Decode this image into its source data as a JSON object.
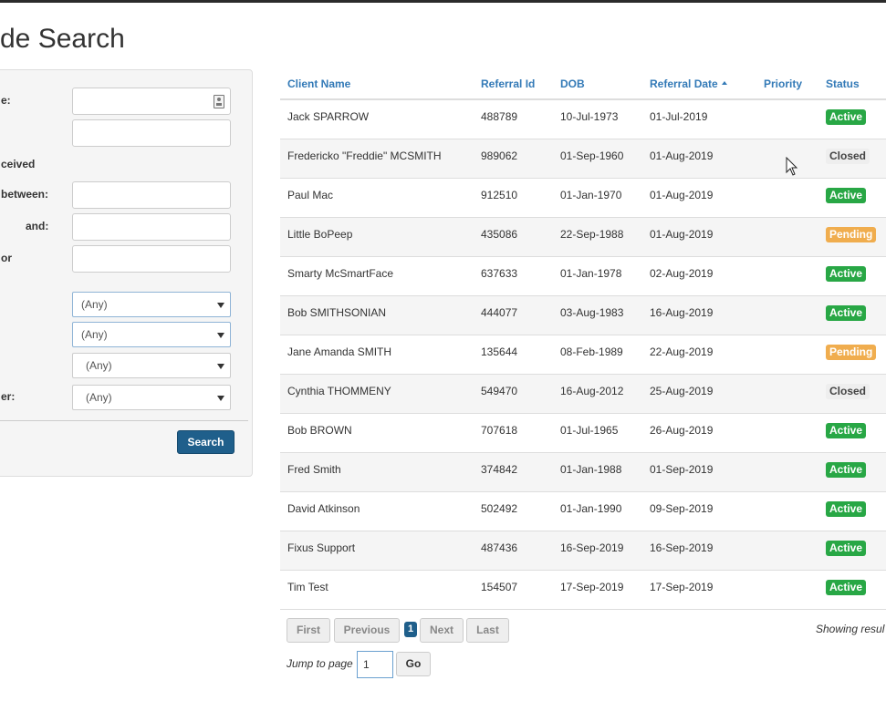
{
  "header": {
    "title": "de Search"
  },
  "filters": {
    "labels": {
      "name": "e:",
      "received": "ceived",
      "between": "between:",
      "and": "and:",
      "or": "or",
      "number": "er:"
    },
    "selects": [
      "(Any)",
      "(Any)",
      "(Any)",
      "(Any)"
    ],
    "search_label": "Search"
  },
  "table": {
    "columns": {
      "client_name": "Client Name",
      "referral_id": "Referral Id",
      "dob": "DOB",
      "referral_date": "Referral Date",
      "priority": "Priority",
      "status": "Status"
    },
    "rows": [
      {
        "name": "Jack SPARROW",
        "id": "488789",
        "dob": "10-Jul-1973",
        "date": "01-Jul-2019",
        "status": "Active"
      },
      {
        "name": "Fredericko \"Freddie\" MCSMITH",
        "id": "989062",
        "dob": "01-Sep-1960",
        "date": "01-Aug-2019",
        "status": "Closed"
      },
      {
        "name": "Paul Mac",
        "id": "912510",
        "dob": "01-Jan-1970",
        "date": "01-Aug-2019",
        "status": "Active"
      },
      {
        "name": "Little BoPeep",
        "id": "435086",
        "dob": "22-Sep-1988",
        "date": "01-Aug-2019",
        "status": "Pending"
      },
      {
        "name": "Smarty McSmartFace",
        "id": "637633",
        "dob": "01-Jan-1978",
        "date": "02-Aug-2019",
        "status": "Active"
      },
      {
        "name": "Bob SMITHSONIAN",
        "id": "444077",
        "dob": "03-Aug-1983",
        "date": "16-Aug-2019",
        "status": "Active"
      },
      {
        "name": "Jane Amanda SMITH",
        "id": "135644",
        "dob": "08-Feb-1989",
        "date": "22-Aug-2019",
        "status": "Pending"
      },
      {
        "name": "Cynthia THOMMENY",
        "id": "549470",
        "dob": "16-Aug-2012",
        "date": "25-Aug-2019",
        "status": "Closed"
      },
      {
        "name": "Bob BROWN",
        "id": "707618",
        "dob": "01-Jul-1965",
        "date": "26-Aug-2019",
        "status": "Active"
      },
      {
        "name": "Fred Smith",
        "id": "374842",
        "dob": "01-Jan-1988",
        "date": "01-Sep-2019",
        "status": "Active"
      },
      {
        "name": "David Atkinson",
        "id": "502492",
        "dob": "01-Jan-1990",
        "date": "09-Sep-2019",
        "status": "Active"
      },
      {
        "name": "Fixus Support",
        "id": "487436",
        "dob": "16-Sep-2019",
        "date": "16-Sep-2019",
        "status": "Active"
      },
      {
        "name": "Tim Test",
        "id": "154507",
        "dob": "17-Sep-2019",
        "date": "17-Sep-2019",
        "status": "Active"
      }
    ]
  },
  "pagination": {
    "first": "First",
    "previous": "Previous",
    "current": "1",
    "next": "Next",
    "last": "Last",
    "showing": "Showing resul",
    "jump_label": "Jump to page",
    "jump_value": "1",
    "go": "Go"
  },
  "colors": {
    "active": "#28a745",
    "pending": "#f0ad4e",
    "closed": "#eeeeee",
    "link": "#337ab7",
    "primary": "#1f5f8b"
  },
  "icons": [
    "id-card-icon",
    "caret-down-icon",
    "sort-ascending-icon",
    "mouse-cursor-icon"
  ]
}
